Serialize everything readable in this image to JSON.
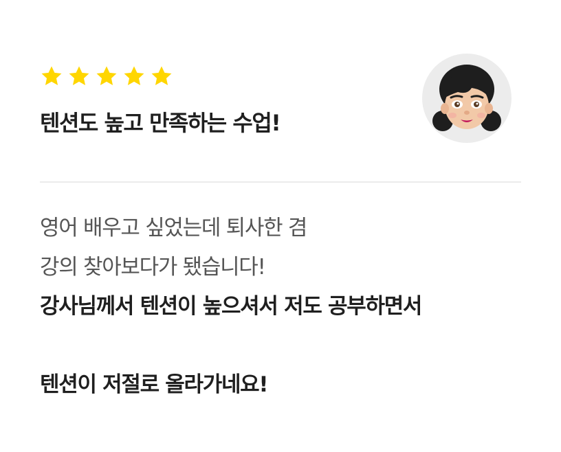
{
  "review": {
    "rating": 5,
    "rating_max": 5,
    "star_color": "#FFD600",
    "title": "텐션도 높고 만족하는 수업!",
    "avatar_icon": "girl-avatar-icon",
    "lines": [
      "영어 배우고 싶었는데 퇴사한 겸",
      "강의 찾아보다가 됐습니다!",
      "강사님께서 텐션이 높으셔서 저도 공부하면서",
      "",
      "텐션이 저절로 올라가네요!"
    ]
  }
}
